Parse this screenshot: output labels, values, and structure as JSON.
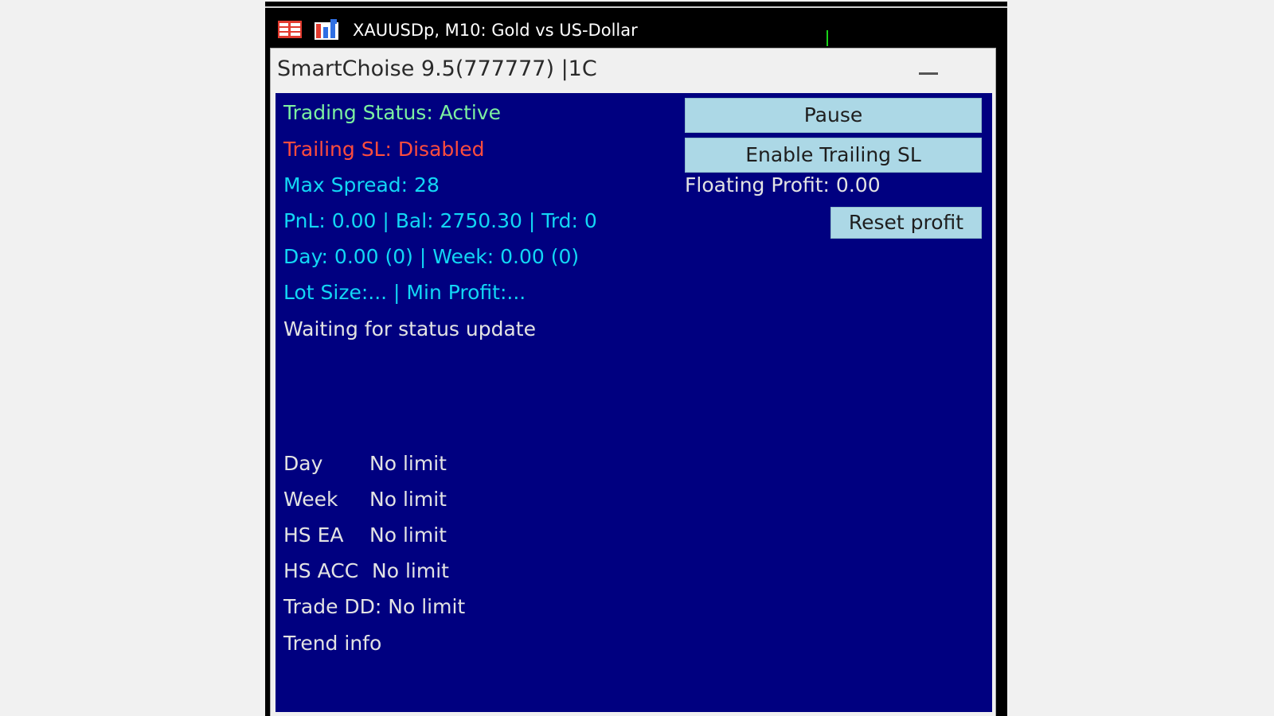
{
  "chart_window": {
    "title": "XAUUSDp, M10:  Gold vs US-Dollar",
    "icons": [
      "grid-icon",
      "chart-icon"
    ]
  },
  "panel": {
    "title": "SmartChoise 9.5(777777)  |1C",
    "minimize_label": "—"
  },
  "status": {
    "trading_status": "Trading Status: Active",
    "trailing_sl": "Trailing SL: Disabled",
    "max_spread": "Max Spread: 28",
    "pnl_line": "PnL: 0.00  |  Bal: 2750.30  |  Trd: 0",
    "day_week": "Day: 0.00 (0) | Week: 0.00 (0)",
    "lot_profit": "Lot Size:... | Min Profit:...",
    "waiting": "Waiting for status update"
  },
  "buttons": {
    "pause": "Pause",
    "enable_trailing": "Enable Trailing SL",
    "reset_profit": "Reset profit"
  },
  "floating_profit": "Floating Profit: 0.00",
  "limits": [
    {
      "label": "Day",
      "value": "No limit"
    },
    {
      "label": "Week",
      "value": "No limit"
    },
    {
      "label": "HS EA",
      "value": "No limit"
    },
    {
      "label": "HS ACC",
      "value": "No limit"
    }
  ],
  "trade_dd": "Trade DD: No limit",
  "trend_info": "Trend info",
  "colors": {
    "background": "#000080",
    "cyan": "#12d7f5",
    "green": "#7cf0a0",
    "red": "#ff4d3d",
    "button": "#acd8e6"
  }
}
